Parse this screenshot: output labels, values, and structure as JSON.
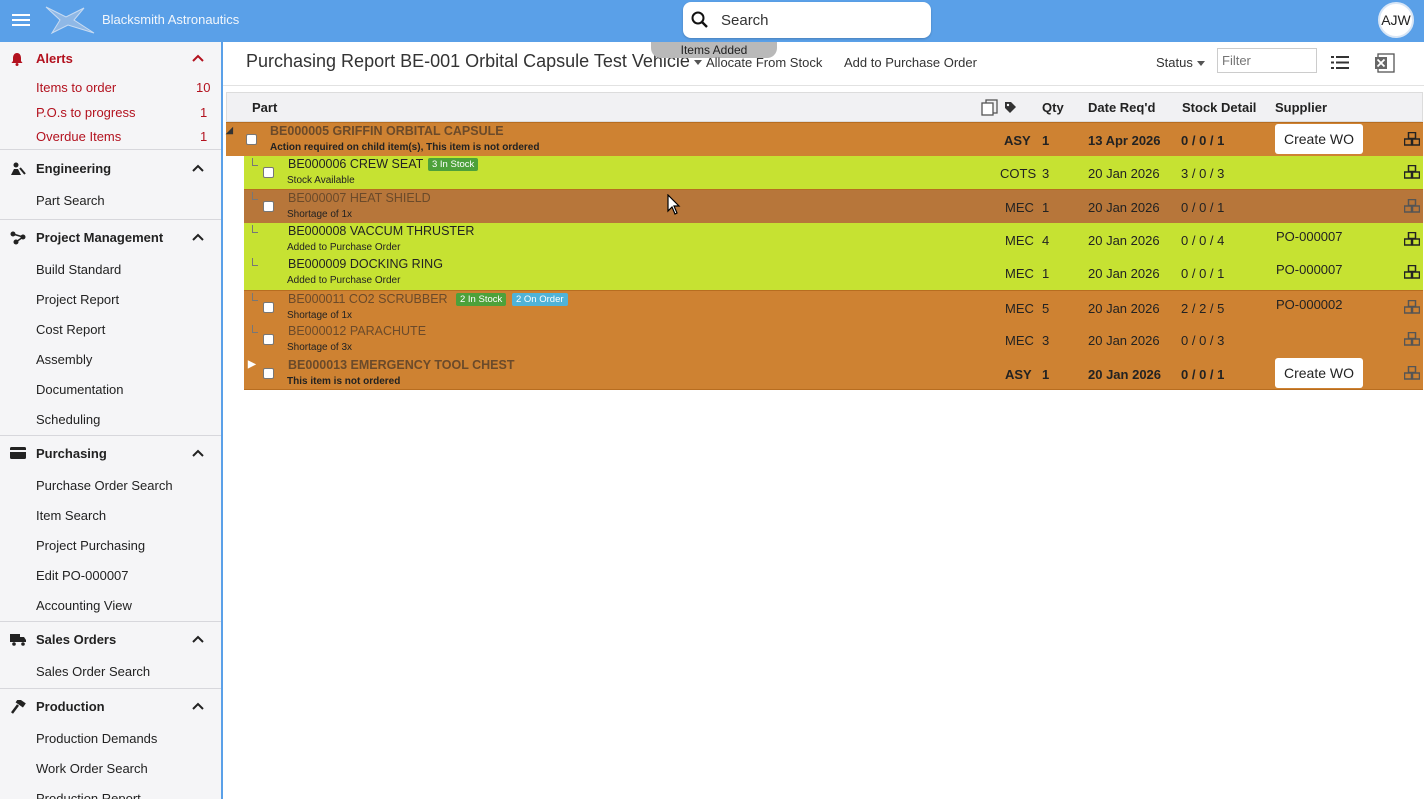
{
  "app": {
    "brand": "Blacksmith Astronautics",
    "search_label": "Search",
    "avatar": "AJW"
  },
  "sidebar": {
    "alerts": {
      "title": "Alerts",
      "items": [
        {
          "label": "Items to order",
          "count": "10"
        },
        {
          "label": "P.O.s to progress",
          "count": "1"
        },
        {
          "label": "Overdue Items",
          "count": "1"
        }
      ]
    },
    "engineering": {
      "title": "Engineering",
      "items": [
        "Part Search"
      ]
    },
    "project_management": {
      "title": "Project Management",
      "items": [
        "Build Standard",
        "Project Report",
        "Cost Report",
        "Assembly",
        "Documentation",
        "Scheduling"
      ]
    },
    "purchasing": {
      "title": "Purchasing",
      "items": [
        "Purchase Order Search",
        "Item Search",
        "Project Purchasing",
        "Edit PO-000007",
        "Accounting View"
      ]
    },
    "sales_orders": {
      "title": "Sales Orders",
      "items": [
        "Sales Order Search"
      ]
    },
    "production": {
      "title": "Production",
      "items": [
        "Production Demands",
        "Work Order Search",
        "Production Report"
      ]
    }
  },
  "toolbar": {
    "title": "Purchasing Report BE-001 Orbital Capsule Test Vehicle",
    "toast": "Items Added",
    "allocate": "Allocate From Stock",
    "add_po": "Add to Purchase Order",
    "status": "Status",
    "filter_placeholder": "Filter"
  },
  "table": {
    "headers": {
      "part": "Part",
      "qty": "Qty",
      "date": "Date Req'd",
      "stock": "Stock Detail",
      "supplier": "Supplier"
    },
    "rows": [
      {
        "name": "BE000005 GRIFFIN ORBITAL CAPSULE",
        "note": "Action required on child item(s), This item is not ordered",
        "type": "ASY",
        "qty": "1",
        "date": "13 Apr 2026",
        "stock": "0 / 0 / 1",
        "supplier": "",
        "button": "Create WO",
        "color": "orange"
      },
      {
        "name": "BE000006 CREW SEAT",
        "badge1": "3 In Stock",
        "note": "Stock Available",
        "type": "COTS",
        "qty": "3",
        "date": "20 Jan 2026",
        "stock": "3 / 0 / 3",
        "supplier": "",
        "color": "green"
      },
      {
        "name": "BE000007 HEAT SHIELD",
        "note": "Shortage of 1x",
        "type": "MEC",
        "qty": "1",
        "date": "20 Jan 2026",
        "stock": "0 / 0 / 1",
        "supplier": "",
        "color": "orange"
      },
      {
        "name": "BE000008 VACCUM THRUSTER",
        "note": "Added to Purchase Order",
        "type": "MEC",
        "qty": "4",
        "date": "20 Jan 2026",
        "stock": "0 / 0 / 4",
        "supplier": "PO-000007",
        "color": "green"
      },
      {
        "name": "BE000009 DOCKING RING",
        "note": "Added to Purchase Order",
        "type": "MEC",
        "qty": "1",
        "date": "20 Jan 2026",
        "stock": "0 / 0 / 1",
        "supplier": "PO-000007",
        "color": "green"
      },
      {
        "name": "BE000011 CO2 SCRUBBER",
        "badge1": "2 In Stock",
        "badge2": "2 On Order",
        "note": "Shortage of 1x",
        "type": "MEC",
        "qty": "5",
        "date": "20 Jan 2026",
        "stock": "2 / 2 / 5",
        "supplier": "PO-000002",
        "color": "orange"
      },
      {
        "name": "BE000012 PARACHUTE",
        "note": "Shortage of 3x",
        "type": "MEC",
        "qty": "3",
        "date": "20 Jan 2026",
        "stock": "0 / 0 / 3",
        "supplier": "",
        "color": "orange"
      },
      {
        "name": "BE000013 EMERGENCY TOOL CHEST",
        "note": "This item is not ordered",
        "type": "ASY",
        "qty": "1",
        "date": "20 Jan 2026",
        "stock": "0 / 0 / 1",
        "supplier": "",
        "button": "Create WO",
        "color": "orange"
      }
    ]
  },
  "colors": {
    "topbar": "#5aa0e8",
    "orange_row": "#ce8232",
    "green_row": "#c6e232",
    "alert_red": "#b3121f"
  }
}
